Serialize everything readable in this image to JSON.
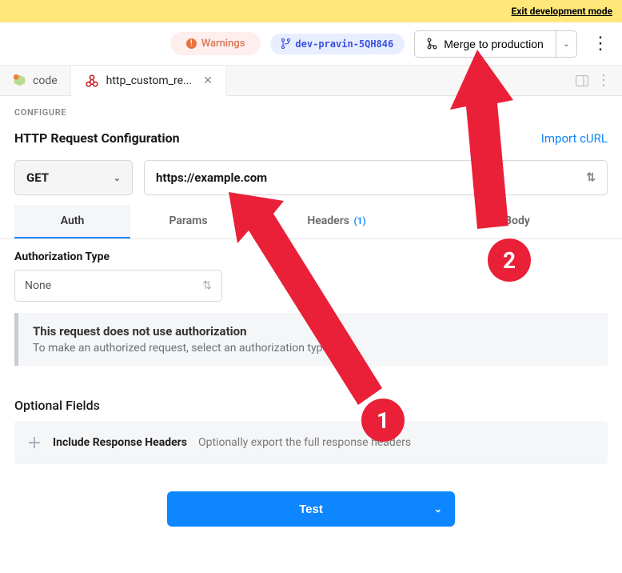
{
  "banner": {
    "exit_label": "Exit development mode"
  },
  "toolbar": {
    "warnings_label": "Warnings",
    "branch_name": "dev-pravin-5QH846",
    "merge_label": "Merge to production"
  },
  "tabs": {
    "code_label": "code",
    "http_label": "http_custom_re..."
  },
  "configure_label": "CONFIGURE",
  "http": {
    "title": "HTTP Request Configuration",
    "import_curl": "Import cURL",
    "method": "GET",
    "url": "https://example.com",
    "subtabs": {
      "auth": "Auth",
      "params": "Params",
      "headers": "Headers",
      "headers_count": "(1)",
      "body": "Body"
    },
    "auth": {
      "label": "Authorization Type",
      "selected": "None",
      "info_title": "This request does not use authorization",
      "info_desc": "To make an authorized request, select an authorization type."
    }
  },
  "optional": {
    "heading": "Optional Fields",
    "include_headers_label": "Include Response Headers",
    "include_headers_desc": "Optionally export the full response headers"
  },
  "test_label": "Test",
  "annotations": {
    "one": "1",
    "two": "2"
  }
}
